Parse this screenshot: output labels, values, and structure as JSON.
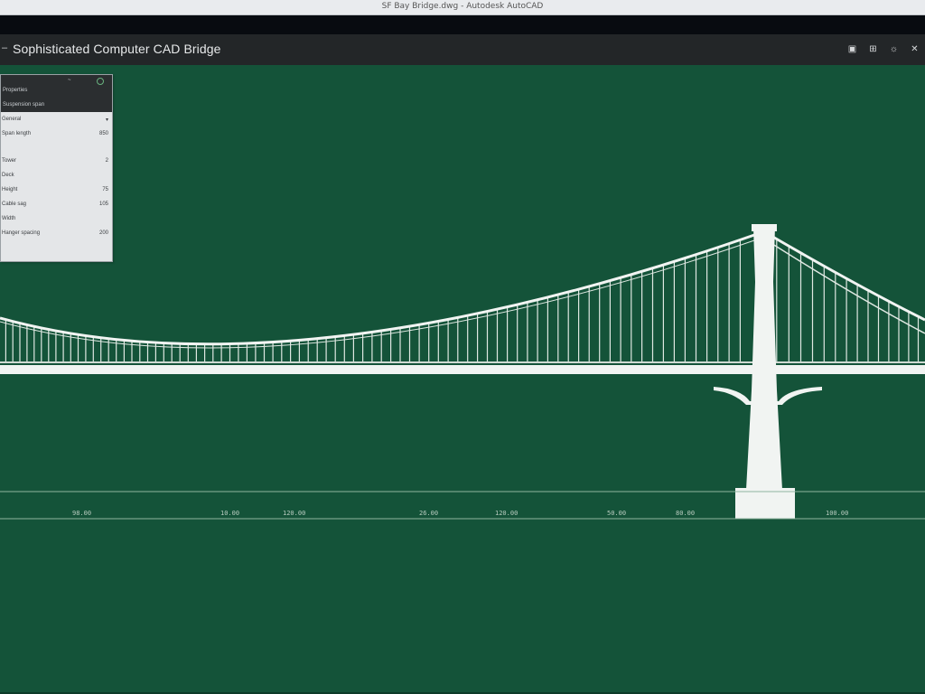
{
  "window": {
    "title": "SF Bay Bridge.dwg - Autodesk AutoCAD"
  },
  "app": {
    "title": "Sophisticated Computer CAD Bridge",
    "menu_icon": "dash-icon"
  },
  "toolbar": [
    {
      "name": "layers-icon",
      "glyph": "▣"
    },
    {
      "name": "grid-icon",
      "glyph": "⊞"
    },
    {
      "name": "settings-icon",
      "glyph": "☼"
    },
    {
      "name": "close-icon",
      "glyph": "✕"
    }
  ],
  "properties": {
    "title": "Properties",
    "control": "~",
    "subtitle": "Suspension span",
    "rows": [
      {
        "label": "General",
        "value": "▾"
      },
      {
        "label": "Span length",
        "value": "850"
      },
      {
        "label": "Tower",
        "value": "2"
      },
      {
        "label": "Deck",
        "value": ""
      },
      {
        "label": "Height",
        "value": "75"
      },
      {
        "label": "Cable sag",
        "value": "105"
      },
      {
        "label": "Width",
        "value": ""
      },
      {
        "label": "Hanger spacing",
        "value": "200"
      }
    ]
  },
  "dimensions": [
    "98.00",
    "10.00",
    "120.00",
    "26.00",
    "120.00",
    "50.00",
    "80.00",
    "100.00"
  ],
  "colors": {
    "canvas": "#145339",
    "lines": "#e8eee9",
    "appbar": "#232628"
  }
}
